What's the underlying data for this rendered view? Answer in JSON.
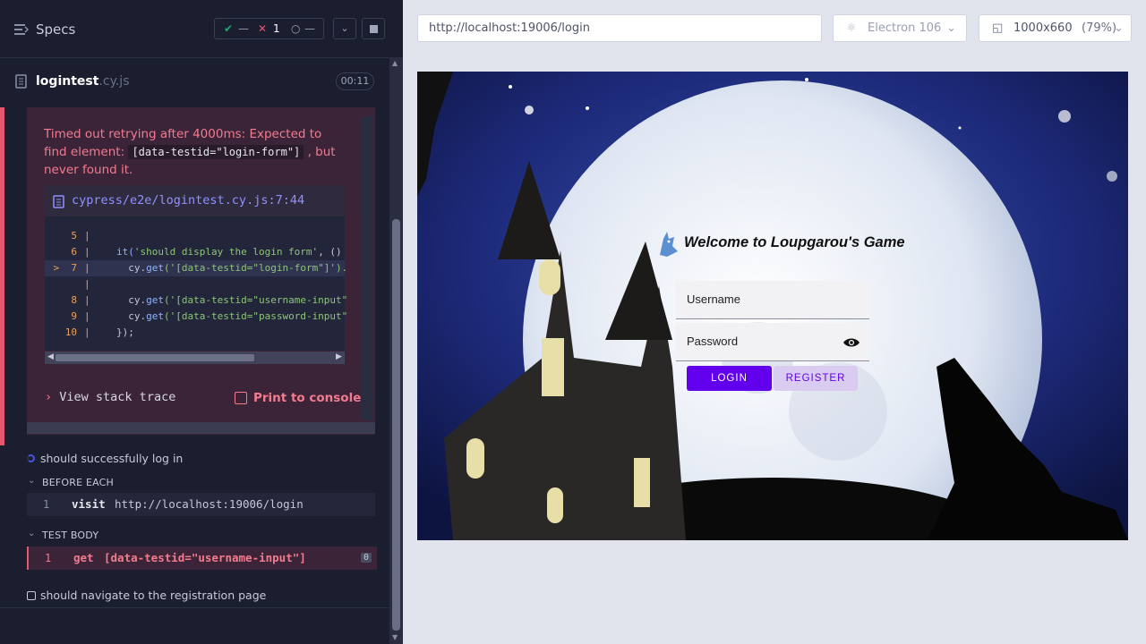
{
  "reporter": {
    "specs_title": "Specs",
    "stats": {
      "passed": "—",
      "failed": "1",
      "pending": "—"
    },
    "file": {
      "name": "logintest",
      "ext": ".cy.js",
      "duration": "00:11"
    },
    "error": {
      "message_part1": "Timed out retrying after 4000ms: Expected to find element:",
      "selector": "[data-testid=\"login-form\"]",
      "message_part2": ", but never found it.",
      "code_path": "cypress/e2e/logintest.cy.js:7:44",
      "code_lines": [
        {
          "num": "5",
          "marker": "",
          "text": ""
        },
        {
          "num": "6",
          "marker": "",
          "text_pre": "it(",
          "text_str": "'should display the login form'",
          "text_post": ", ()"
        },
        {
          "num": "7",
          "marker": ">",
          "text_pre": "  cy.",
          "text_fn": "get",
          "text_str": "('[data-testid=\"login-form\"]').",
          "text_post": ""
        },
        {
          "num": "",
          "marker": "",
          "text": ""
        },
        {
          "num": "8",
          "marker": "",
          "text_pre": "  cy.",
          "text_fn": "get",
          "text_str": "('[data-testid=\"username-input\"",
          "text_post": ""
        },
        {
          "num": "9",
          "marker": "",
          "text_pre": "  cy.",
          "text_fn": "get",
          "text_str": "('[data-testid=\"password-input\"",
          "text_post": ""
        },
        {
          "num": "10",
          "marker": "",
          "text_pre": "});",
          "text_str": "",
          "text_post": ""
        }
      ],
      "view_stack": "View stack trace",
      "print_console": "Print to console"
    },
    "tests": [
      {
        "title": "should successfully log in",
        "state": "running"
      },
      {
        "title": "should navigate to the registration page",
        "state": "pending"
      }
    ],
    "before_each_label": "BEFORE EACH",
    "test_body_label": "TEST BODY",
    "before_each_cmd": {
      "num": "1",
      "name": "visit",
      "message": "http://localhost:19006/login"
    },
    "test_body_cmd": {
      "num": "1",
      "name": "get",
      "message": "[data-testid=\"username-input\"]",
      "count": "0"
    }
  },
  "browser": {
    "url": "http://localhost:19006/login",
    "browser_name": "Electron 106",
    "viewport": "1000x660",
    "zoom": "(79%)"
  },
  "app": {
    "welcome": "Welcome to Loupgarou's Game",
    "username_label": "Username",
    "password_label": "Password",
    "login_label": "LOGIN",
    "register_label": "REGISTER"
  },
  "colors": {
    "failed": "#e45770",
    "passed": "#1fa971",
    "primary": "#6200ee"
  }
}
